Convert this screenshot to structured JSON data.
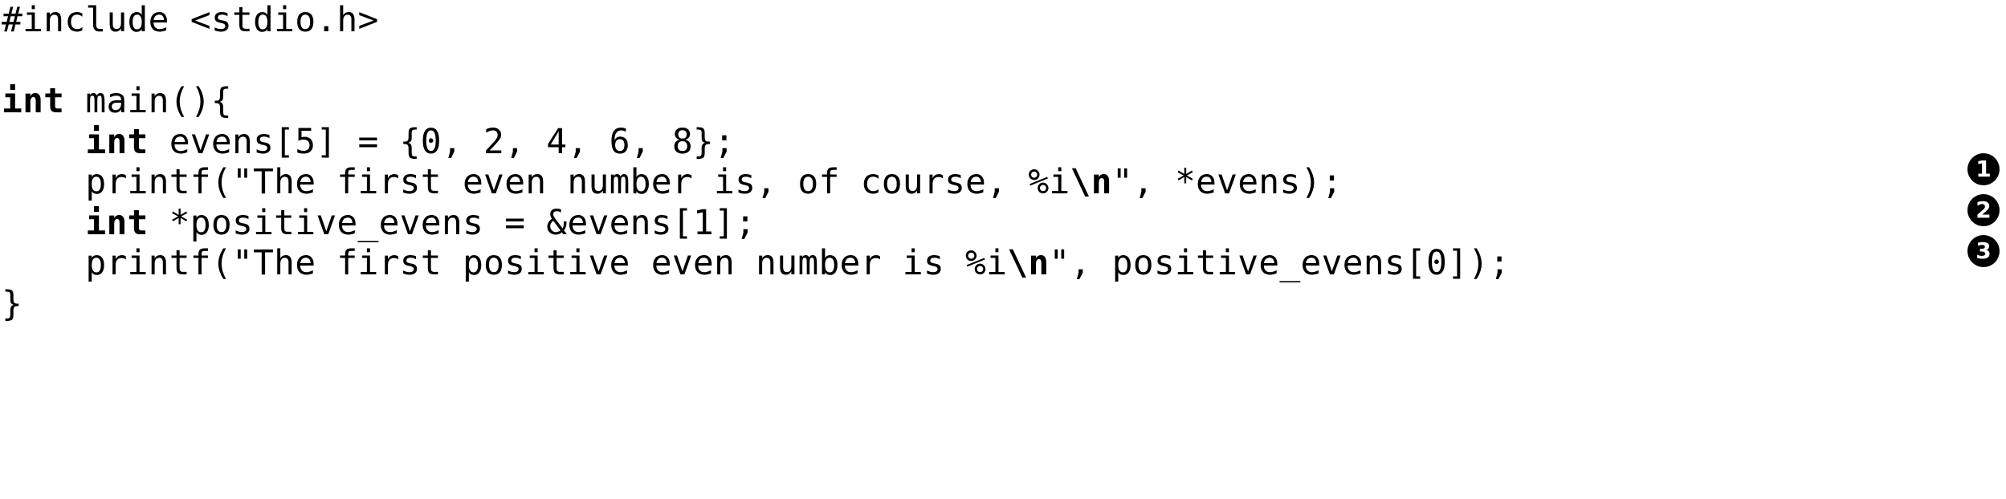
{
  "code": {
    "language": "c",
    "lines": [
      {
        "id": "line-include",
        "segments": [
          {
            "text": "#include <stdio.h>",
            "bold": false
          }
        ]
      },
      {
        "id": "line-blank",
        "segments": []
      },
      {
        "id": "line-main",
        "segments": [
          {
            "text": "int",
            "bold": true
          },
          {
            "text": " main(){",
            "bold": false
          }
        ]
      },
      {
        "id": "line-evens-decl",
        "segments": [
          {
            "text": "    ",
            "bold": false
          },
          {
            "text": "int",
            "bold": true
          },
          {
            "text": " evens[5] = {0, 2, 4, 6, 8};",
            "bold": false
          }
        ]
      },
      {
        "id": "line-printf-first-even",
        "segments": [
          {
            "text": "    printf(\"The first even number is, of course, %i",
            "bold": false
          },
          {
            "text": "\\n",
            "bold": true
          },
          {
            "text": "\", *evens);",
            "bold": false
          }
        ]
      },
      {
        "id": "line-positive-evens-decl",
        "segments": [
          {
            "text": "    ",
            "bold": false
          },
          {
            "text": "int",
            "bold": true
          },
          {
            "text": " *positive_evens = &evens[1];",
            "bold": false
          }
        ]
      },
      {
        "id": "line-printf-first-positive",
        "segments": [
          {
            "text": "    printf(\"The first positive even number is %i",
            "bold": false
          },
          {
            "text": "\\n",
            "bold": true
          },
          {
            "text": "\", positive_evens[0]);",
            "bold": false
          }
        ]
      },
      {
        "id": "line-close-brace",
        "segments": [
          {
            "text": "}",
            "bold": false
          }
        ]
      }
    ]
  },
  "annotations": {
    "badges": [
      {
        "label": "1",
        "target_line": "line-printf-first-even"
      },
      {
        "label": "2",
        "target_line": "line-positive-evens-decl"
      },
      {
        "label": "3",
        "target_line": "line-printf-first-positive"
      }
    ]
  },
  "colors": {
    "background": "#ffffff",
    "text": "#000000",
    "badge_background": "#000000",
    "badge_text": "#ffffff"
  }
}
